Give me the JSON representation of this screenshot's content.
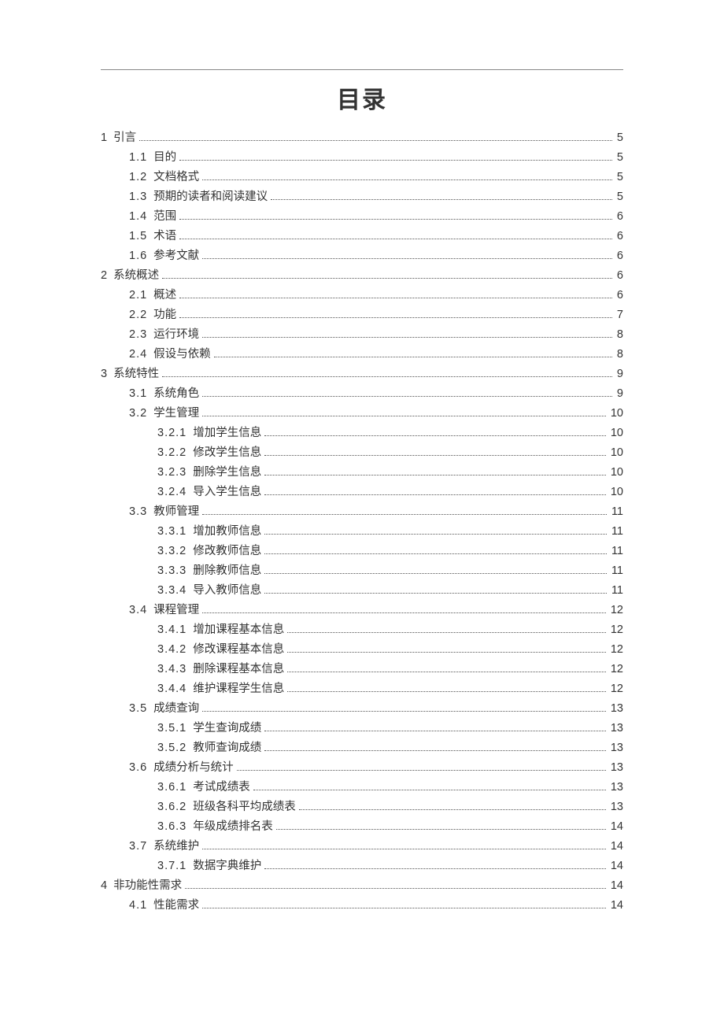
{
  "title": "目录",
  "entries": [
    {
      "level": 0,
      "num": "1",
      "label": "引言",
      "page": "5"
    },
    {
      "level": 1,
      "num": "1.1",
      "label": "目的",
      "page": "5"
    },
    {
      "level": 1,
      "num": "1.2",
      "label": "文档格式",
      "page": "5"
    },
    {
      "level": 1,
      "num": "1.3",
      "label": "预期的读者和阅读建议",
      "page": "5"
    },
    {
      "level": 1,
      "num": "1.4",
      "label": "范围",
      "page": "6"
    },
    {
      "level": 1,
      "num": "1.5",
      "label": "术语",
      "page": "6"
    },
    {
      "level": 1,
      "num": "1.6",
      "label": "参考文献",
      "page": "6"
    },
    {
      "level": 0,
      "num": "2",
      "label": "系统概述",
      "page": "6"
    },
    {
      "level": 1,
      "num": "2.1",
      "label": "概述",
      "page": "6"
    },
    {
      "level": 1,
      "num": "2.2",
      "label": "功能",
      "page": "7"
    },
    {
      "level": 1,
      "num": "2.3",
      "label": "运行环境",
      "page": "8"
    },
    {
      "level": 1,
      "num": "2.4",
      "label": "假设与依赖",
      "page": "8"
    },
    {
      "level": 0,
      "num": "3",
      "label": "系统特性",
      "page": "9"
    },
    {
      "level": 1,
      "num": "3.1",
      "label": "系统角色",
      "page": "9"
    },
    {
      "level": 1,
      "num": "3.2",
      "label": "学生管理",
      "page": "10"
    },
    {
      "level": 2,
      "num": "3.2.1",
      "label": "增加学生信息",
      "page": "10"
    },
    {
      "level": 2,
      "num": "3.2.2",
      "label": "修改学生信息",
      "page": "10"
    },
    {
      "level": 2,
      "num": "3.2.3",
      "label": "删除学生信息",
      "page": "10"
    },
    {
      "level": 2,
      "num": "3.2.4",
      "label": "导入学生信息",
      "page": "10"
    },
    {
      "level": 1,
      "num": "3.3",
      "label": "教师管理",
      "page": "11"
    },
    {
      "level": 2,
      "num": "3.3.1",
      "label": "增加教师信息",
      "page": "11"
    },
    {
      "level": 2,
      "num": "3.3.2",
      "label": "修改教师信息",
      "page": "11"
    },
    {
      "level": 2,
      "num": "3.3.3",
      "label": "删除教师信息",
      "page": "11"
    },
    {
      "level": 2,
      "num": "3.3.4",
      "label": "导入教师信息",
      "page": "11"
    },
    {
      "level": 1,
      "num": "3.4",
      "label": "课程管理",
      "page": "12"
    },
    {
      "level": 2,
      "num": "3.4.1",
      "label": "增加课程基本信息",
      "page": "12"
    },
    {
      "level": 2,
      "num": "3.4.2",
      "label": "修改课程基本信息",
      "page": "12"
    },
    {
      "level": 2,
      "num": "3.4.3",
      "label": "删除课程基本信息",
      "page": "12"
    },
    {
      "level": 2,
      "num": "3.4.4",
      "label": "维护课程学生信息",
      "page": "12"
    },
    {
      "level": 1,
      "num": "3.5",
      "label": "成绩查询",
      "page": "13"
    },
    {
      "level": 2,
      "num": "3.5.1",
      "label": "学生查询成绩",
      "page": "13"
    },
    {
      "level": 2,
      "num": "3.5.2",
      "label": "教师查询成绩",
      "page": "13"
    },
    {
      "level": 1,
      "num": "3.6",
      "label": "成绩分析与统计",
      "page": "13"
    },
    {
      "level": 2,
      "num": "3.6.1",
      "label": "考试成绩表",
      "page": "13"
    },
    {
      "level": 2,
      "num": "3.6.2",
      "label": "班级各科平均成绩表",
      "page": "13"
    },
    {
      "level": 2,
      "num": "3.6.3",
      "label": "年级成绩排名表",
      "page": "14"
    },
    {
      "level": 1,
      "num": "3.7",
      "label": "系统维护",
      "page": "14"
    },
    {
      "level": 2,
      "num": "3.7.1",
      "label": "数据字典维护",
      "page": "14"
    },
    {
      "level": 0,
      "num": "4",
      "label": "非功能性需求",
      "page": "14"
    },
    {
      "level": 1,
      "num": "4.1",
      "label": "性能需求",
      "page": "14"
    }
  ]
}
